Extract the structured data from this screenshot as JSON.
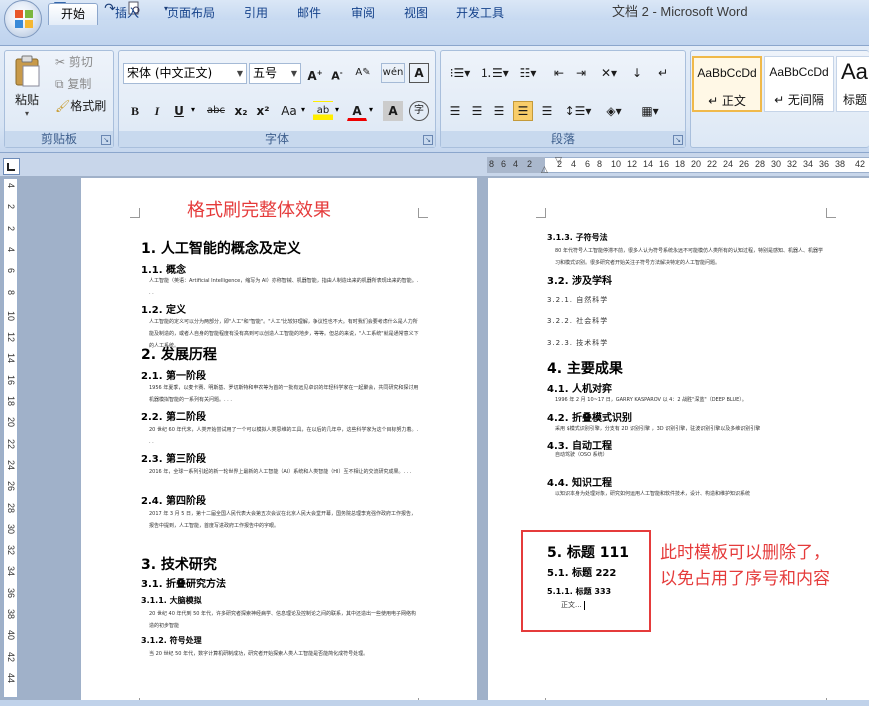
{
  "window": {
    "title": "文档 2 - Microsoft Word"
  },
  "quick_access": {
    "icons": [
      "save-icon",
      "undo-icon",
      "redo-icon",
      "print-preview-icon",
      "customize-icon"
    ]
  },
  "tabs": [
    "开始",
    "插入",
    "页面布局",
    "引用",
    "邮件",
    "审阅",
    "视图",
    "开发工具"
  ],
  "clipboard": {
    "paste": "粘贴",
    "cut": "剪切",
    "copy": "复制",
    "format_painter": "格式刷",
    "label": "剪贴板"
  },
  "font": {
    "name": "宋体 (中文正文)",
    "size": "五号",
    "label": "字体",
    "buttons": [
      "B",
      "I",
      "U",
      "abc",
      "x₂",
      "x²",
      "Aa",
      "A",
      "A"
    ]
  },
  "paragraph": {
    "label": "段落"
  },
  "styles": [
    {
      "sample": "AaBbCcDd",
      "name": "↵ 正文"
    },
    {
      "sample": "AaBbCcDd",
      "name": "↵ 无间隔"
    },
    {
      "sample": "Aa",
      "name": "标题"
    }
  ],
  "ruler": {
    "numbers": [
      "8",
      "6",
      "4",
      "2",
      "2",
      "4",
      "6",
      "8",
      "10",
      "12",
      "14",
      "16",
      "18",
      "20",
      "22",
      "24",
      "26",
      "28",
      "30",
      "32",
      "34",
      "36",
      "38",
      "42",
      "44",
      "4"
    ]
  },
  "vruler": {
    "numbers": [
      "4",
      "2",
      "2",
      "4",
      "6",
      "8",
      "10",
      "12",
      "14",
      "16",
      "18",
      "20",
      "22",
      "24",
      "26",
      "28",
      "30",
      "32",
      "34",
      "36",
      "38",
      "40",
      "42",
      "44"
    ]
  },
  "page1": {
    "red_title": "格式刷完整体效果",
    "items": [
      {
        "k": "h1",
        "t": "1. 人工智能的概念及定义"
      },
      {
        "k": "h2",
        "t": "1.1. 概念"
      },
      {
        "k": "body",
        "t": "人工智能（英语：Artificial Intelligence，缩写为 AI）亦称智械、机器智能，指由人制造出来的机器所表现出来的智能。. . ."
      },
      {
        "k": "h2",
        "t": "1.2. 定义"
      },
      {
        "k": "body",
        "t": "人工智能的定义可以分为两部分，即\"人工\"和\"智能\"。\"人工\"比较好理解，争议性也不大。有时我们会要考虑什么是人力所能及制造的，或者人自身的智能程度有没有高到可以创造人工智能的地步，等等。但总的来说，\"人工系统\"就是通常意义下的人工系统。"
      },
      {
        "k": "h1",
        "t": "2. 发展历程"
      },
      {
        "k": "h2",
        "t": "2.1. 第一阶段"
      },
      {
        "k": "body",
        "t": "1956 年夏季，以麦卡赛、明斯基、罗切斯特和申农等为首的一批有远见卓识的年轻科学家在一起聚会，共同研究和探讨用机器模拟智能的一系列有关问题。. . ."
      },
      {
        "k": "h2",
        "t": "2.2. 第二阶段"
      },
      {
        "k": "body",
        "t": "20 世纪 60 年代末，人类开始尝试用了一个可以模拟人类思维的工具，在以后的几年中，这些科学家为这个目标努力着。. . ."
      },
      {
        "k": "h2",
        "t": "2.3. 第三阶段"
      },
      {
        "k": "body",
        "t": "2016 年，全球一系列引起的新一轮世界上最新的人工智能（AI）系统和人类智能（HI）互不相让的交流研究成果。. . ."
      },
      {
        "k": "h2",
        "t": "2.4. 第四阶段"
      },
      {
        "k": "body",
        "t": "2017 年 3 月 5 日，第十二届全国人民代表大会第五次会议在北京人民大会堂开幕，国务院总理李克强作政府工作报告，报告中提到，人工智能，首度写进政府工作报告中的字眼。"
      },
      {
        "k": "h1",
        "t": "3. 技术研究"
      },
      {
        "k": "h2",
        "t": "3.1. 折叠研究方法"
      },
      {
        "k": "h3",
        "t": "3.1.1. 大脑模拟"
      },
      {
        "k": "body",
        "t": "20 世纪 40 年代到 50 年代，许多研究者探索神经病学、信息理论及控制论之间的联系，其中还造出一些使用电子网络构造的初步智能"
      },
      {
        "k": "h3",
        "t": "3.1.2. 符号处理"
      },
      {
        "k": "body",
        "t": "当 20 世纪 50 年代，数字计算机研制成功，研究者开始探索人类人工智能是否能简化成符号处理。"
      }
    ]
  },
  "page2": {
    "items": [
      {
        "k": "h3",
        "t": "3.1.3. 子符号法"
      },
      {
        "k": "body",
        "t": "80 年代符号人工智能停滞不前，很多人认为符号系统永远不可能模仿人类所有的认知过程，特别是感知、机器人、机器学习和模式识别。很多研究者开始关注子符号方法解决特定的人工智能问题。"
      },
      {
        "k": "h2",
        "t": "3.2. 涉及学科"
      },
      {
        "k": "body2",
        "t": "3.2.1. 自然科学"
      },
      {
        "k": "body2",
        "t": "3.2.2. 社会科学"
      },
      {
        "k": "body2",
        "t": "3.2.3. 技术科学"
      },
      {
        "k": "h1",
        "t": "4. 主要成果"
      },
      {
        "k": "h2",
        "t": "4.1. 人机对弈"
      },
      {
        "k": "body",
        "t": "1996 年 2 月 10~17 日，GARRY KASPAROV 以 4：2 战胜\"深蓝\"（DEEP BLUE）。"
      },
      {
        "k": "h2",
        "t": "4.2. 折叠模式识别"
      },
      {
        "k": "body",
        "t": "采用 $模式识别引擎，分支有 2D 识别引擎 ，3D 识别引擎，驻波识别引擎以及多维识别引擎"
      },
      {
        "k": "h2",
        "t": "4.3. 自动工程"
      },
      {
        "k": "body",
        "t": "自动驾驶（OSO 系统）"
      },
      {
        "k": "h2",
        "t": "4.4. 知识工程"
      },
      {
        "k": "body",
        "t": "以知识本身为处理对象，研究如何运用人工智能和软件技术，设计、构造和维护知识系统"
      }
    ],
    "template_box": {
      "h1": "5. 标题 111",
      "h2": "5.1. 标题 222",
      "h3": "5.1.1. 标题 333",
      "body": "正文..."
    },
    "note_lines": [
      "此时模板可以删除了，",
      "以免占用了序号和内容"
    ]
  }
}
